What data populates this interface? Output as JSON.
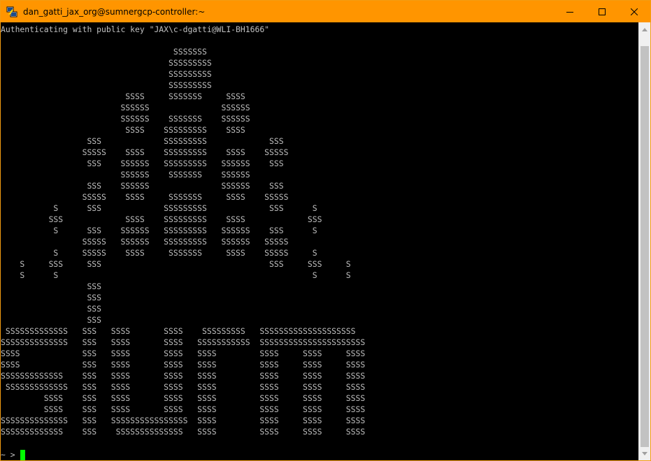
{
  "window": {
    "title": "dan_gatti_jax_org@sumnergcp-controller:~",
    "accent_color": "#ff9500"
  },
  "terminal": {
    "auth_line": "Authenticating with public key \"JAX\\c-dgatti@WLI-BH1666\"",
    "banner_lines": [
      "                                    SSSSSSS",
      "                                   SSSSSSSSS",
      "                                   SSSSSSSSS",
      "                                   SSSSSSSSS",
      "                          SSSS     SSSSSSS     SSSS",
      "                         SSSSSS               SSSSSS",
      "                         SSSSSS    SSSSSSS    SSSSSS",
      "                          SSSS    SSSSSSSSS    SSSS",
      "                  SSS             SSSSSSSSS             SSS",
      "                 SSSSS    SSSS    SSSSSSSSS    SSSS    SSSSS",
      "                  SSS    SSSSSS   SSSSSSSSS   SSSSSS    SSS",
      "                         SSSSSS    SSSSSSS    SSSSSS",
      "                  SSS    SSSSSS               SSSSSS    SSS",
      "                 SSSSS    SSSS     SSSSSSS     SSSS    SSSSS",
      "           S      SSS             SSSSSSSSS             SSS      S",
      "          SSS             SSSS    SSSSSSSSS    SSSS             SSS",
      "           S      SSS    SSSSSS   SSSSSSSSS   SSSSSS    SSS      S",
      "                 SSSSS   SSSSSS   SSSSSSSSS   SSSSSS   SSSSS",
      "           S     SSSSS    SSSS     SSSSSSS     SSSS    SSSSS     S",
      "    S     SSS     SSS                                   SSS     SSS     S",
      "    S      S                                                     S      S",
      "                  SSS",
      "                  SSS",
      "                  SSS",
      "                  SSS",
      " SSSSSSSSSSSSS   SSS   SSSS       SSSS    SSSSSSSSS   SSSSSSSSSSSSSSSSSSSS",
      "SSSSSSSSSSSSSS   SSS   SSSS       SSSS   SSSSSSSSSSS  SSSSSSSSSSSSSSSSSSSSSS",
      "SSSS             SSS   SSSS       SSSS   SSSS         SSSS     SSSS     SSSS",
      "SSSS             SSS   SSSS       SSSS   SSSS         SSSS     SSSS     SSSS",
      "SSSSSSSSSSSSS    SSS   SSSS       SSSS   SSSS         SSSS     SSSS     SSSS",
      " SSSSSSSSSSSSS   SSS   SSSS       SSSS   SSSS         SSSS     SSSS     SSSS",
      "         SSSS    SSS   SSSS       SSSS   SSSS         SSSS     SSSS     SSSS",
      "         SSSS    SSS   SSSS       SSSS   SSSS         SSSS     SSSS     SSSS",
      "SSSSSSSSSSSSSS   SSS   SSSSSSSSSSSSSSSS  SSSS         SSSS     SSSS     SSSS",
      "SSSSSSSSSSSSS    SSS    SSSSSSSSSSSSSS   SSSS         SSSS     SSSS     SSSS"
    ],
    "prompt": "~ > ",
    "cursor_color": "#00ff00"
  },
  "icons": {
    "app": "putty-icon",
    "minimize": "minimize-icon",
    "maximize": "maximize-icon",
    "close": "close-icon"
  }
}
